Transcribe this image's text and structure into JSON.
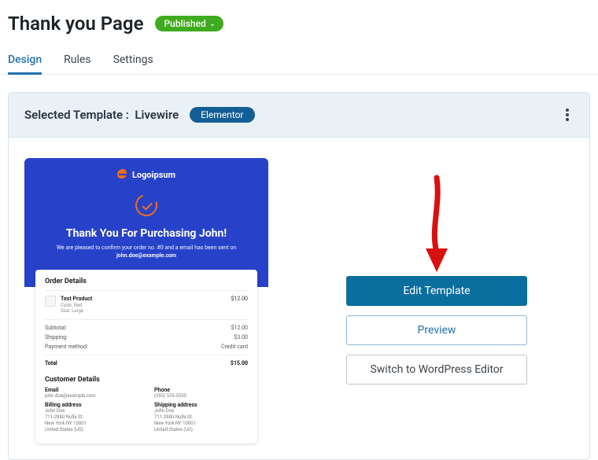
{
  "header": {
    "title": "Thank you Page",
    "status": "Published"
  },
  "tabs": {
    "design": "Design",
    "rules": "Rules",
    "settings": "Settings"
  },
  "panel": {
    "selectedLabel": "Selected Template :",
    "templateName": "Livewire",
    "builderBadge": "Elementor"
  },
  "preview": {
    "brand": "Logoipsum",
    "heroTitle": "Thank You For Purchasing John!",
    "heroLine1": "We are pleased to confirm your order no. #0 and a email has been sent on",
    "heroEmail": "john.doe@example.com",
    "order": {
      "title": "Order Details",
      "productName": "Test Product",
      "productSub1": "Color: Red",
      "productSub2": "Size: Large",
      "productPrice": "$12.00",
      "subtotalLabel": "Subtotal:",
      "subtotalVal": "$12.00",
      "shippingLabel": "Shipping:",
      "shippingVal": "$3.00",
      "paymentLabel": "Payment method:",
      "paymentVal": "Credit card",
      "totalLabel": "Total",
      "totalVal": "$15.00"
    },
    "customer": {
      "title": "Customer Details",
      "emailLabel": "Email",
      "emailVal": "john.doe@example.com",
      "phoneLabel": "Phone",
      "phoneVal": "(555) 555-5555",
      "billingLabel": "Billing address",
      "shippingLabel": "Shipping address",
      "addrName": "John Doe",
      "addr1": "711-2880 Nulla St.",
      "addr2": "New York NY 10001",
      "addr3": "United States (US)"
    }
  },
  "actions": {
    "edit": "Edit Template",
    "preview": "Preview",
    "switch": "Switch to WordPress Editor"
  }
}
